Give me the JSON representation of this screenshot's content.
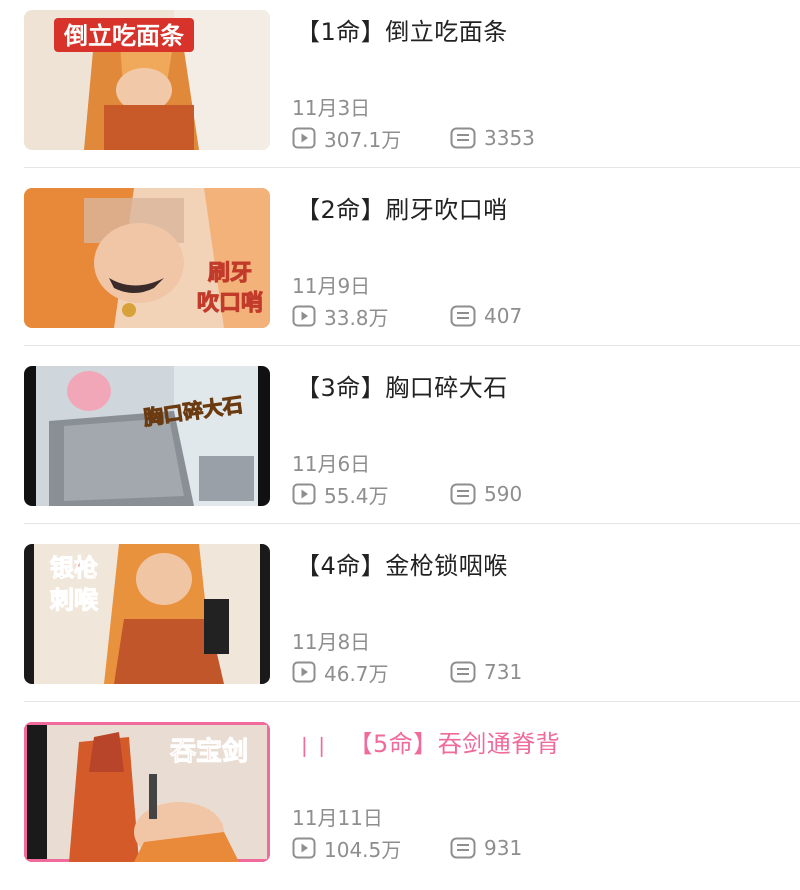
{
  "items": [
    {
      "title": "【1命】倒立吃面条",
      "date": "11月3日",
      "views": "307.1万",
      "comments": "3353",
      "thumb_text": "倒立吃面条",
      "active": false
    },
    {
      "title": "【2命】刷牙吹口哨",
      "date": "11月9日",
      "views": "33.8万",
      "comments": "407",
      "thumb_text": "刷牙吹口哨",
      "active": false
    },
    {
      "title": "【3命】胸口碎大石",
      "date": "11月6日",
      "views": "55.4万",
      "comments": "590",
      "thumb_text": "胸口碎大石",
      "active": false
    },
    {
      "title": "【4命】金枪锁咽喉",
      "date": "11月8日",
      "views": "46.7万",
      "comments": "731",
      "thumb_text": "银枪刺喉",
      "active": false
    },
    {
      "title": "【5命】吞剑通脊背",
      "date": "11月11日",
      "views": "104.5万",
      "comments": "931",
      "thumb_text": "吞宝剑",
      "active": true
    }
  ],
  "colors": {
    "accent": "#f06a9b",
    "meta": "#8e8e8e"
  },
  "icons": {
    "views": "play-count-icon",
    "comments": "comment-count-icon",
    "playing": "playing-bars-icon"
  }
}
